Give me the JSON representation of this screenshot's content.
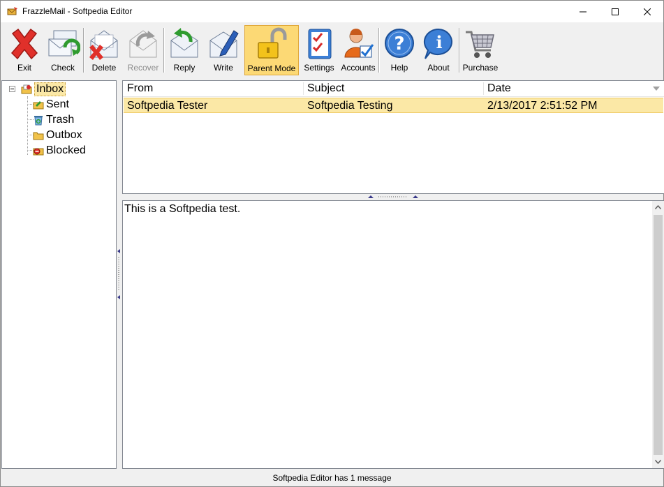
{
  "window": {
    "title": "FrazzleMail - Softpedia Editor"
  },
  "toolbar": {
    "exit": "Exit",
    "check": "Check",
    "delete": "Delete",
    "recover": "Recover",
    "reply": "Reply",
    "write": "Write",
    "parent_mode": "Parent Mode",
    "settings": "Settings",
    "accounts": "Accounts",
    "help": "Help",
    "about": "About",
    "purchase": "Purchase"
  },
  "folders": {
    "inbox": "Inbox",
    "sent": "Sent",
    "trash": "Trash",
    "outbox": "Outbox",
    "blocked": "Blocked"
  },
  "message_list": {
    "columns": {
      "from": "From",
      "subject": "Subject",
      "date": "Date"
    },
    "rows": [
      {
        "from": "Softpedia Tester",
        "subject": "Softpedia Testing",
        "date": "2/13/2017 2:51:52 PM"
      }
    ]
  },
  "preview": {
    "body": "This is a Softpedia test."
  },
  "status": {
    "text": "Softpedia Editor has 1 message"
  },
  "colors": {
    "selection": "#fbe8a6",
    "active_button": "#fcd975",
    "accent_blue": "#1e6fd0"
  }
}
